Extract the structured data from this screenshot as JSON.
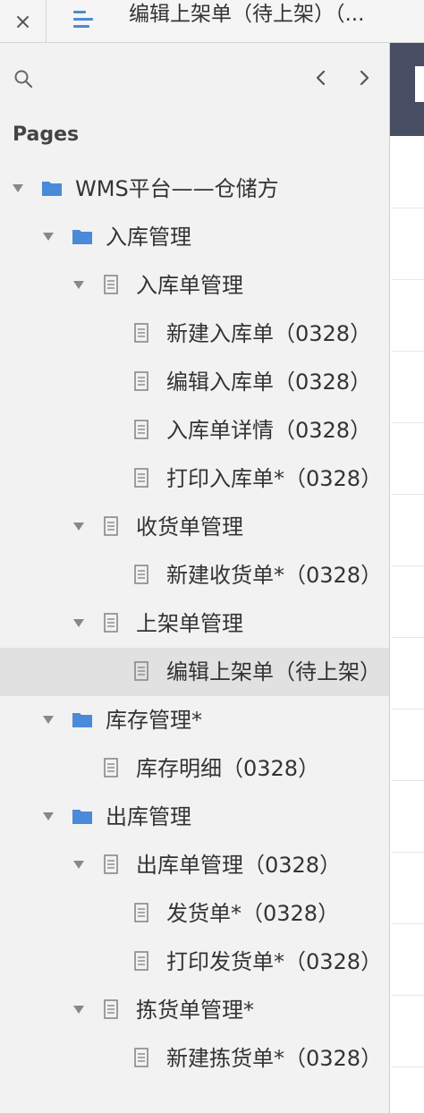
{
  "topbar": {
    "close_glyph": "×",
    "menu_icon": "menu-lines-icon",
    "tab_title": "编辑上架单（待上架）（..."
  },
  "sidebar": {
    "search_icon": "search-icon",
    "prev_icon": "chevron-left-icon",
    "next_icon": "chevron-right-icon",
    "pages_label": "Pages",
    "tree": [
      {
        "label": "WMS平台——仓储方",
        "type": "folder",
        "expanded": true,
        "selected": false
      },
      {
        "label": "入库管理",
        "type": "folder",
        "expanded": true,
        "selected": false
      },
      {
        "label": "入库单管理",
        "type": "page",
        "expanded": true,
        "selected": false
      },
      {
        "label": "新建入库单（0328）",
        "type": "page",
        "expanded": false,
        "selected": false
      },
      {
        "label": "编辑入库单（0328）",
        "type": "page",
        "expanded": false,
        "selected": false
      },
      {
        "label": "入库单详情（0328）",
        "type": "page",
        "expanded": false,
        "selected": false
      },
      {
        "label": "打印入库单*（0328）",
        "type": "page",
        "expanded": false,
        "selected": false
      },
      {
        "label": "收货单管理",
        "type": "page",
        "expanded": true,
        "selected": false
      },
      {
        "label": "新建收货单*（0328）",
        "type": "page",
        "expanded": false,
        "selected": false
      },
      {
        "label": "上架单管理",
        "type": "page",
        "expanded": true,
        "selected": false
      },
      {
        "label": "编辑上架单（待上架）",
        "type": "page",
        "expanded": false,
        "selected": true
      },
      {
        "label": "库存管理*",
        "type": "folder",
        "expanded": true,
        "selected": false
      },
      {
        "label": "库存明细（0328）",
        "type": "page",
        "expanded": false,
        "selected": false
      },
      {
        "label": "出库管理",
        "type": "folder",
        "expanded": true,
        "selected": false
      },
      {
        "label": "出库单管理（0328）",
        "type": "page",
        "expanded": true,
        "selected": false
      },
      {
        "label": "发货单*（0328）",
        "type": "page",
        "expanded": false,
        "selected": false
      },
      {
        "label": "打印发货单*（0328）",
        "type": "page",
        "expanded": false,
        "selected": false
      },
      {
        "label": "拣货单管理*",
        "type": "page",
        "expanded": true,
        "selected": false
      },
      {
        "label": "新建拣货单*（0328）",
        "type": "page",
        "expanded": false,
        "selected": false
      }
    ]
  },
  "colors": {
    "folder": "#4a8ad8",
    "page_icon": "#888888",
    "selected_row": "#e1e1e1",
    "canvas_header": "#474d62"
  }
}
